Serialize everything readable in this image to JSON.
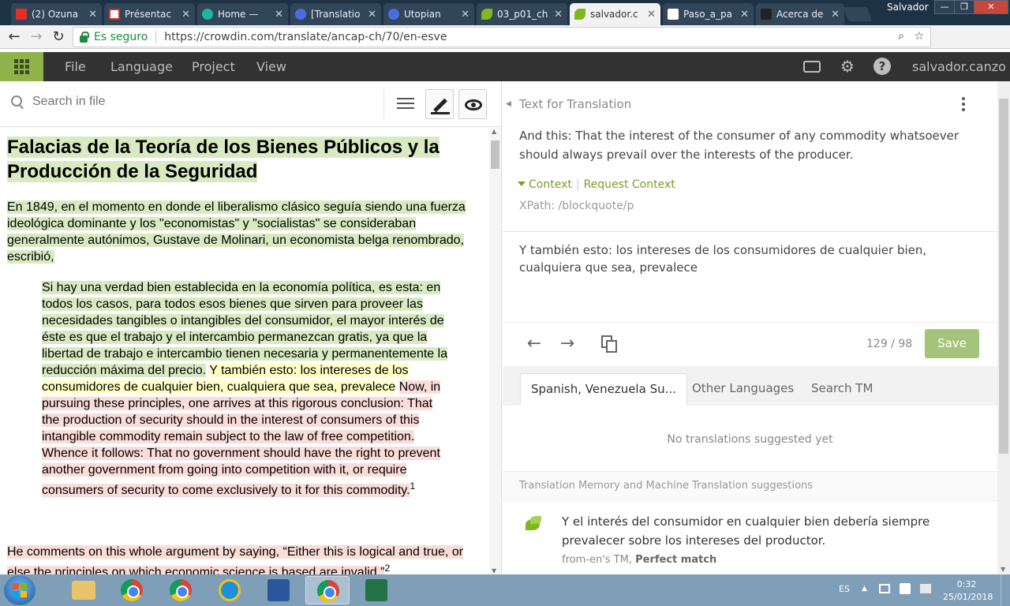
{
  "browser": {
    "tabs": [
      {
        "title": "(2) Ozuna",
        "icon_color": "#e52d27"
      },
      {
        "title": "Présentac",
        "icon_color": "#d93025"
      },
      {
        "title": "Home —",
        "icon_color": "#1bb5a0"
      },
      {
        "title": "[Translatio",
        "icon_color": "#4a6ee0"
      },
      {
        "title": "Utopian",
        "icon_color": "#4a6ee0"
      },
      {
        "title": "03_p01_ch",
        "icon_color": "#7fb81e"
      },
      {
        "title": "salvador.c",
        "icon_color": "#7fb81e",
        "active": true
      },
      {
        "title": "Paso_a_pa",
        "icon_color": "#dddddd"
      },
      {
        "title": "Acerca de",
        "icon_color": "#222222"
      }
    ],
    "profile_name": "Salvador",
    "secure_label": "Es seguro",
    "url_host": "https://crowdin.com",
    "url_path": "/translate/ancap-ch/70/en-esve"
  },
  "app": {
    "menu": [
      "File",
      "Language",
      "Project",
      "View"
    ],
    "username": "salvador.canzo",
    "accent_color": "#8fb34a"
  },
  "editor": {
    "search_placeholder": "Search in file",
    "document": {
      "title": "Falacias de la Teoría de los Bienes Públicos y la Producción de la Seguridad",
      "p1": "En 1849, en el momento en donde el liberalismo clásico seguía siendo una fuerza ideológica dominante y los \"economistas\" y \"socialistas\" se consideraban generalmente autónimos, Gustave de Molinari, un economista belga renombrado, escribió,",
      "bq_green": "Si hay una verdad bien establecida en la economía política, es esta: en todos los casos, para todos esos bienes que sirven para proveer las necesidades tangibles o intangibles del consumidor, el mayor interés de éste es que el trabajo y el intercambio permanezcan gratis, ya que la libertad de trabajo e intercambio tienen necesaria y permanentemente la reducción máxima del precio.",
      "bq_yellow": "Y también esto: los intereses de los consumidores de cualquier bien, cualquiera que sea, prevalece",
      "bq_red_1": "Now, in pursuing these principles, one arrives at this rigorous conclusion: That the production of security should in the interest of consumers of this intangible commodity remain subject to the law of free competition.",
      "bq_red_2": "Whence it follows: That no government should have the right to prevent another government from going into competition with it, or require consumers of security to come exclusively to it for this commodity.",
      "bq_footnote": "1",
      "p2": "He comments on this whole argument by saying, “Either this is logical and true, or else the principles on which economic science is based are invalid.”",
      "p2_footnote": "2"
    }
  },
  "panel": {
    "header": "Text for Translation",
    "source_text": "And this: That the interest of the consumer of any commodity whatsoever should always prevail over the interests of the producer.",
    "context_label": "Context",
    "request_context_label": "Request Context",
    "xpath": "XPath: /blockquote/p",
    "translation_text": "Y también esto: los intereses de los consumidores de cualquier bien, cualquiera que sea, prevalece",
    "counter": "129 / 98",
    "save_label": "Save",
    "tabs": [
      "Spanish, Venezuela Su...",
      "Other Languages",
      "Search TM"
    ],
    "no_translations": "No translations suggested yet",
    "tm_header": "Translation Memory and Machine Translation suggestions",
    "tm_suggestion": "Y el interés del consumidor en cualquier bien debería siempre prevalecer sobre los intereses del productor.",
    "tm_source": "from-en's TM,",
    "tm_match": "Perfect match"
  },
  "taskbar": {
    "language": "ES",
    "time": "0:32",
    "date": "25/01/2018"
  }
}
